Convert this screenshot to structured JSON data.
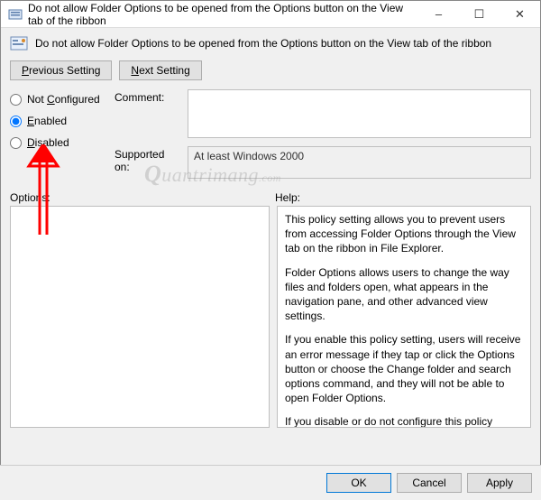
{
  "window": {
    "title": "Do not allow Folder Options to be opened from the Options button on the View tab of the ribbon"
  },
  "header": {
    "text": "Do not allow Folder Options to be opened from the Options button on the View tab of the ribbon"
  },
  "nav": {
    "prev": "Previous Setting",
    "next": "Next Setting"
  },
  "radios": {
    "not_configured": "Not Configured",
    "enabled": "Enabled",
    "disabled": "Disabled",
    "selected": "enabled"
  },
  "labels": {
    "comment": "Comment:",
    "supported": "Supported on:",
    "options": "Options:",
    "help": "Help:"
  },
  "comment": "",
  "supported": "At least Windows 2000",
  "help": {
    "p1": "This policy setting allows you to prevent users from accessing Folder Options through the View tab on the ribbon in File Explorer.",
    "p2": "Folder Options allows users to change the way files and folders open, what appears in the navigation pane, and other advanced view settings.",
    "p3": "If you enable this policy setting, users will receive an error message if they tap or click the Options button or choose the Change folder and search options command, and they will not be able to open Folder Options.",
    "p4": "If you disable or do not configure this policy setting, users can open Folder Options from the View tab on the ribbon."
  },
  "buttons": {
    "ok": "OK",
    "cancel": "Cancel",
    "apply": "Apply"
  },
  "watermark": "uantrimang"
}
